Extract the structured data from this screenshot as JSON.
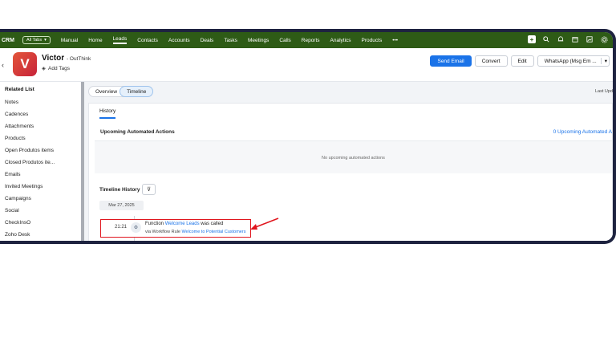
{
  "app": {
    "brand": "CRM",
    "all_tabs": "All Tabs",
    "all_tabs_caret": "▾"
  },
  "nav": [
    "Manual",
    "Home",
    "Leads",
    "Contacts",
    "Accounts",
    "Deals",
    "Tasks",
    "Meetings",
    "Calls",
    "Reports",
    "Analytics",
    "Products",
    "•••"
  ],
  "nav_active": "Leads",
  "nav_icons": [
    "plus-icon",
    "search-icon",
    "bell-icon",
    "calendar-icon",
    "gallery-icon",
    "settings-icon"
  ],
  "record": {
    "back": "‹",
    "avatar_letter": "V",
    "name": "Victor",
    "company": "- OutThink",
    "add_tags": "Add Tags",
    "tag_icon": "◈"
  },
  "actions": {
    "send_email": "Send Email",
    "convert": "Convert",
    "edit": "Edit",
    "whatsapp": "WhatsApp (Msg Em ...",
    "caret": "▾"
  },
  "sidebar": {
    "title": "Related List",
    "items": [
      "Notes",
      "Cadences",
      "Attachments",
      "Products",
      "Open Produtos items",
      "Closed Produtos ite...",
      "Emails",
      "Invited Meetings",
      "Campaigns",
      "Social",
      "CheckInsO",
      "Zoho Desk"
    ]
  },
  "tabs": {
    "overview": "Overview",
    "timeline": "Timeline"
  },
  "last_updated": "Last Upd",
  "subtab": "History",
  "upcoming": {
    "title": "Upcoming Automated Actions",
    "link": "0 Upcoming Automated A",
    "empty": "No upcoming automated actions"
  },
  "timeline": {
    "title": "Timeline History",
    "filter_icon": "⊽",
    "date": "Mar 27, 2025",
    "entry": {
      "time": "21:21",
      "icon": "⚙",
      "text_prefix": "Function",
      "function_name": "Welcome Leads",
      "text_suffix": "was called",
      "via_prefix": "via Workflow Rule",
      "rule_name": "Welcome to Potential Customers"
    }
  },
  "colors": {
    "nav_bg": "#2e5b16",
    "accent": "#1a73e8",
    "highlight": "#e0161e",
    "frame": "#1e2340"
  }
}
